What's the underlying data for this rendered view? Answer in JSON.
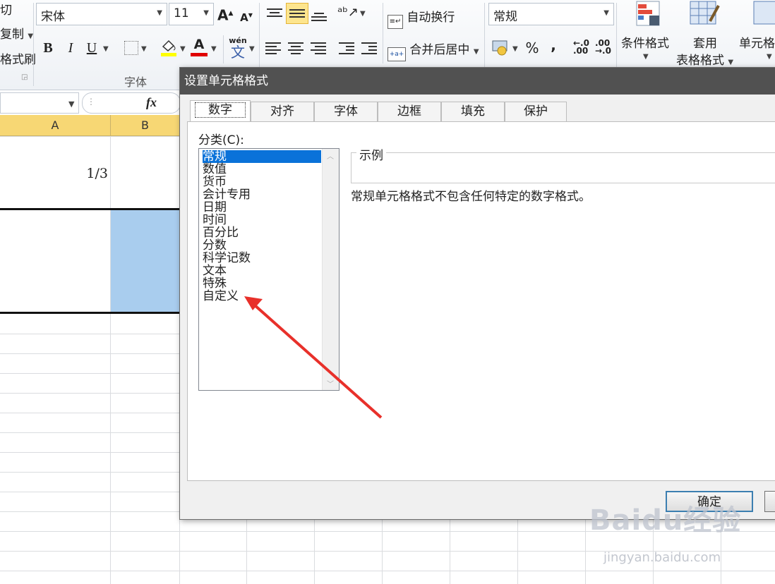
{
  "ribbon": {
    "clipboard": {
      "cut": "切",
      "copy": "复制",
      "format_painter": "格式刷"
    },
    "font": {
      "name": "宋体",
      "size": "11",
      "group_label": "字体",
      "bold": "B",
      "italic": "I",
      "underline": "U",
      "phonetic": "wén",
      "phonetic_char": "文",
      "grow_icon": "A",
      "shrink_icon": "A",
      "font_color_icon": "A"
    },
    "alignment": {
      "wrap_text": "自动换行",
      "merge_center": "合并后居中",
      "merge_icon_text": "+a+"
    },
    "number": {
      "format": "常规",
      "percent": "%",
      "comma": ","
    },
    "styles": {
      "conditional_format": "条件格式",
      "table_format_line1": "套用",
      "table_format_line2": "表格格式",
      "cell_styles": "单元格"
    }
  },
  "sheet": {
    "fx": "fx",
    "columns": [
      "A",
      "B"
    ],
    "cell_a1": "1/3"
  },
  "dialog": {
    "title": "设置单元格格式",
    "tabs": [
      "数字",
      "对齐",
      "字体",
      "边框",
      "填充",
      "保护"
    ],
    "category_label": "分类(C):",
    "categories": [
      "常规",
      "数值",
      "货币",
      "会计专用",
      "日期",
      "时间",
      "百分比",
      "分数",
      "科学记数",
      "文本",
      "特殊",
      "自定义"
    ],
    "selected_category": "常规",
    "sample_label": "示例",
    "description": "常规单元格格式不包含任何特定的数字格式。",
    "ok": "确定"
  },
  "watermark": {
    "main": "Baidu经验",
    "sub": "jingyan.baidu.com"
  },
  "colors": {
    "accent_selection": "#0a72d9",
    "annotation_arrow": "#e8302a",
    "column_header": "#f7d774",
    "selected_cell": "#a9cdee",
    "dialog_title": "#515151"
  }
}
